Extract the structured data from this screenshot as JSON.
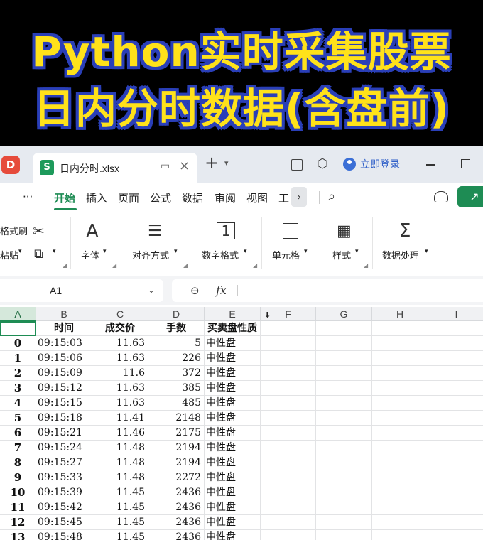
{
  "banner": {
    "line1": "Python实时采集股票",
    "line2": "日内分时数据(含盘前)"
  },
  "titlebar": {
    "app_icon": "D",
    "doc_icon": "S",
    "doc_title": "日内分时.xlsx",
    "new_tab": "+",
    "login": "立即登录"
  },
  "menu": {
    "more": "···",
    "items": [
      "开始",
      "插入",
      "页面",
      "公式",
      "数据",
      "审阅",
      "视图",
      "工"
    ],
    "overflow": "›"
  },
  "ribbon": {
    "format_painter": "格式刷",
    "paste": "粘贴",
    "groups": [
      "字体",
      "对齐方式",
      "数字格式",
      "单元格",
      "样式",
      "数据处理"
    ]
  },
  "formula_bar": {
    "name_box": "A1",
    "fx": "fx",
    "content": ""
  },
  "sheet": {
    "columns": [
      "A",
      "B",
      "C",
      "D",
      "E",
      "F",
      "G",
      "H",
      "I"
    ],
    "header_row": [
      "",
      "时间",
      "成交价",
      "手数",
      "买卖盘性质"
    ],
    "rows": [
      [
        "0",
        "09:15:03",
        "11.63",
        "5",
        "中性盘"
      ],
      [
        "1",
        "09:15:06",
        "11.63",
        "226",
        "中性盘"
      ],
      [
        "2",
        "09:15:09",
        "11.6",
        "372",
        "中性盘"
      ],
      [
        "3",
        "09:15:12",
        "11.63",
        "385",
        "中性盘"
      ],
      [
        "4",
        "09:15:15",
        "11.63",
        "485",
        "中性盘"
      ],
      [
        "5",
        "09:15:18",
        "11.41",
        "2148",
        "中性盘"
      ],
      [
        "6",
        "09:15:21",
        "11.46",
        "2175",
        "中性盘"
      ],
      [
        "7",
        "09:15:24",
        "11.48",
        "2194",
        "中性盘"
      ],
      [
        "8",
        "09:15:27",
        "11.48",
        "2194",
        "中性盘"
      ],
      [
        "9",
        "09:15:33",
        "11.48",
        "2272",
        "中性盘"
      ],
      [
        "10",
        "09:15:39",
        "11.45",
        "2436",
        "中性盘"
      ],
      [
        "11",
        "09:15:42",
        "11.45",
        "2436",
        "中性盘"
      ],
      [
        "12",
        "09:15:45",
        "11.45",
        "2436",
        "中性盘"
      ],
      [
        "13",
        "09:15:48",
        "11.45",
        "2436",
        "中性盘"
      ]
    ]
  }
}
